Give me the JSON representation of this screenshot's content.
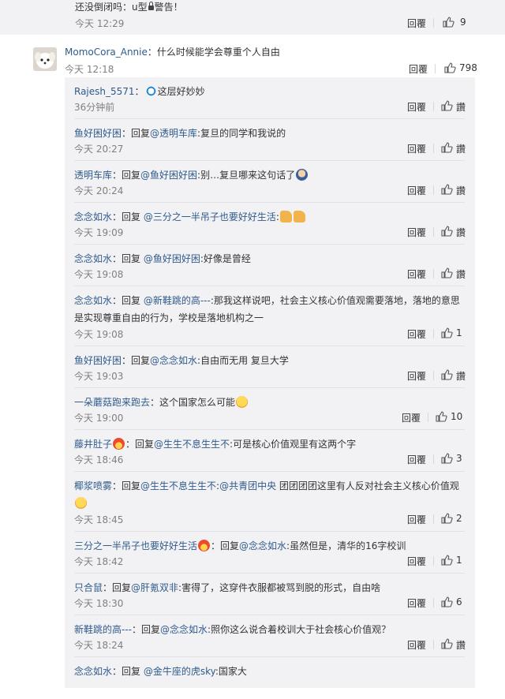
{
  "previous_comment": {
    "text": "还没倒闭吗：u型🔒警告！",
    "time": "今天 12:29",
    "reply_label": "回覆",
    "likes": "9"
  },
  "main_comment": {
    "user": "MomoCora_Annie",
    "text": "：什么时候能学会尊重个人自由",
    "time": "今天 12:18",
    "reply_label": "回覆",
    "likes": "798"
  },
  "replies": [
    {
      "user": "Rajesh_5571",
      "text": "：",
      "emoji": "blue",
      "text_after": "这层好妙妙",
      "time": "36分钟前",
      "reply_label": "回覆",
      "likes": "讚"
    },
    {
      "user": "鱼好困好困",
      "text": "：回复",
      "mention": "@透明车库",
      "text_after": ":复旦的同学和我说的",
      "time": "今天 20:27",
      "reply_label": "回覆",
      "likes": "讚"
    },
    {
      "user": "透明车库",
      "text": "：回复",
      "mention": "@鱼好困好困",
      "text_after": ":别…复旦哪来这句话了",
      "emoji_after": "mask",
      "time": "今天 20:24",
      "reply_label": "回覆",
      "likes": "讚"
    },
    {
      "user": "念念如水",
      "text": "：回复 ",
      "mention": "@三分之一半吊子也要好好生活",
      "text_after": ":",
      "emoji_after": "thumb",
      "time": "今天 19:09",
      "reply_label": "回覆",
      "likes": "讚"
    },
    {
      "user": "念念如水",
      "text": "：回复 ",
      "mention": "@鱼好困好困",
      "text_after": ":好像是曾经",
      "time": "今天 19:08",
      "reply_label": "回覆",
      "likes": "讚"
    },
    {
      "user": "念念如水",
      "text": "：回复 ",
      "mention": "@新鞋跳的高---",
      "text_after": ":那我这样说吧，社会主义核心价值观需要落地，落地的意思是实现尊重自由的行为，学校是落地机构之一",
      "time": "今天 19:08",
      "reply_label": "回覆",
      "likes": "1"
    },
    {
      "user": "鱼好困好困",
      "text": "：回复",
      "mention": "@念念如水",
      "text_after": ":自由而无用 复旦大学",
      "time": "今天 19:03",
      "reply_label": "回覆",
      "likes": "讚"
    },
    {
      "user": "一朵蘑菇跑来跑去",
      "text": "：这个国家怎么可能",
      "emoji_after": "cry",
      "time": "今天 19:00",
      "reply_label": "回覆",
      "likes": "10"
    },
    {
      "user": "藤井肚子",
      "emoji_user": "fire",
      "text": "：回复",
      "mention": "@生生不息生生不",
      "text_after": ":可是核心价值观里有这两个字",
      "time": "今天 18:46",
      "reply_label": "回覆",
      "likes": "3"
    },
    {
      "user": "椰浆喷雾",
      "text": "：回复",
      "mention": "@生生不息生生不",
      "text_after": ":",
      "mention2": "@共青团中央",
      "text_after2": " 团团团团这里有人反对社会主义核心价值观",
      "emoji_after": "cry",
      "time": "今天 18:45",
      "reply_label": "回覆",
      "likes": "2"
    },
    {
      "user": "三分之一半吊子也要好好生活",
      "emoji_user": "fire",
      "text": "：回复",
      "mention": "@念念如水",
      "text_after": ":虽然但是，清华的16字校训",
      "time": "今天 18:42",
      "reply_label": "回覆",
      "likes": "1"
    },
    {
      "user": "只合鼠",
      "text": "：回复",
      "mention": "@肝氪双非",
      "text_after": ":害得了，这穿件衣服都被骂到脱的形式，自由啥",
      "time": "今天 18:30",
      "reply_label": "回覆",
      "likes": "6"
    },
    {
      "user": "新鞋跳的高---",
      "text": "：回复",
      "mention": "@念念如水",
      "text_after": ":照你这么说合着校训大于社会核心价值观？",
      "time": "今天 18:24",
      "reply_label": "回覆",
      "likes": "讚"
    },
    {
      "user": "念念如水",
      "text": "：回复 ",
      "mention": "@金牛座的虎sky",
      "text_after": ":国家大",
      "time": "",
      "reply_label": "",
      "likes": ""
    }
  ],
  "icons": {
    "like": "thumbs-up-icon",
    "lock": "lock-icon"
  },
  "colors": {
    "link": "#2f5b8b",
    "panel_bg": "#f2f2f5",
    "meta": "#808080"
  }
}
